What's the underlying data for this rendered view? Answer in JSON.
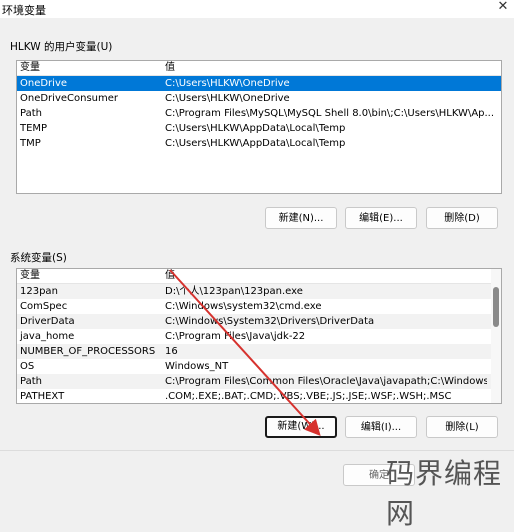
{
  "window": {
    "title": "环境变量"
  },
  "user_group": {
    "label": "HLKW 的用户变量(U)",
    "columns": [
      "变量",
      "值"
    ],
    "rows": [
      [
        "OneDrive",
        "C:\\Users\\HLKW\\OneDrive"
      ],
      [
        "OneDriveConsumer",
        "C:\\Users\\HLKW\\OneDrive"
      ],
      [
        "Path",
        "C:\\Program Files\\MySQL\\MySQL Shell 8.0\\bin\\;C:\\Users\\HLKW\\Ap..."
      ],
      [
        "TEMP",
        "C:\\Users\\HLKW\\AppData\\Local\\Temp"
      ],
      [
        "TMP",
        "C:\\Users\\HLKW\\AppData\\Local\\Temp"
      ]
    ],
    "selected_row": "OneDrive",
    "buttons": {
      "new": "新建(N)...",
      "edit": "编辑(E)...",
      "delete": "删除(D)"
    }
  },
  "system_group": {
    "label": "系统变量(S)",
    "columns": [
      "变量",
      "值"
    ],
    "rows": [
      [
        "123pan",
        "D:\\个人\\123pan\\123pan.exe"
      ],
      [
        "ComSpec",
        "C:\\Windows\\system32\\cmd.exe"
      ],
      [
        "DriverData",
        "C:\\Windows\\System32\\Drivers\\DriverData"
      ],
      [
        "java_home",
        "C:\\Program Files\\Java\\jdk-22"
      ],
      [
        "NUMBER_OF_PROCESSORS",
        "16"
      ],
      [
        "OS",
        "Windows_NT"
      ],
      [
        "Path",
        "C:\\Program Files\\Common Files\\Oracle\\Java\\javapath;C:\\Windows\\..."
      ],
      [
        "PATHEXT",
        ".COM;.EXE;.BAT;.CMD;.VBS;.VBE;.JS;.JSE;.WSF;.WSH;.MSC"
      ]
    ],
    "buttons": {
      "new": "新建(W)...",
      "edit": "编辑(I)...",
      "delete": "删除(L)"
    }
  },
  "footer": {
    "ok": "确定"
  },
  "watermark": "码界编程网",
  "colors": {
    "selection": "#0078d7",
    "annotation_arrow": "#d6322e"
  }
}
